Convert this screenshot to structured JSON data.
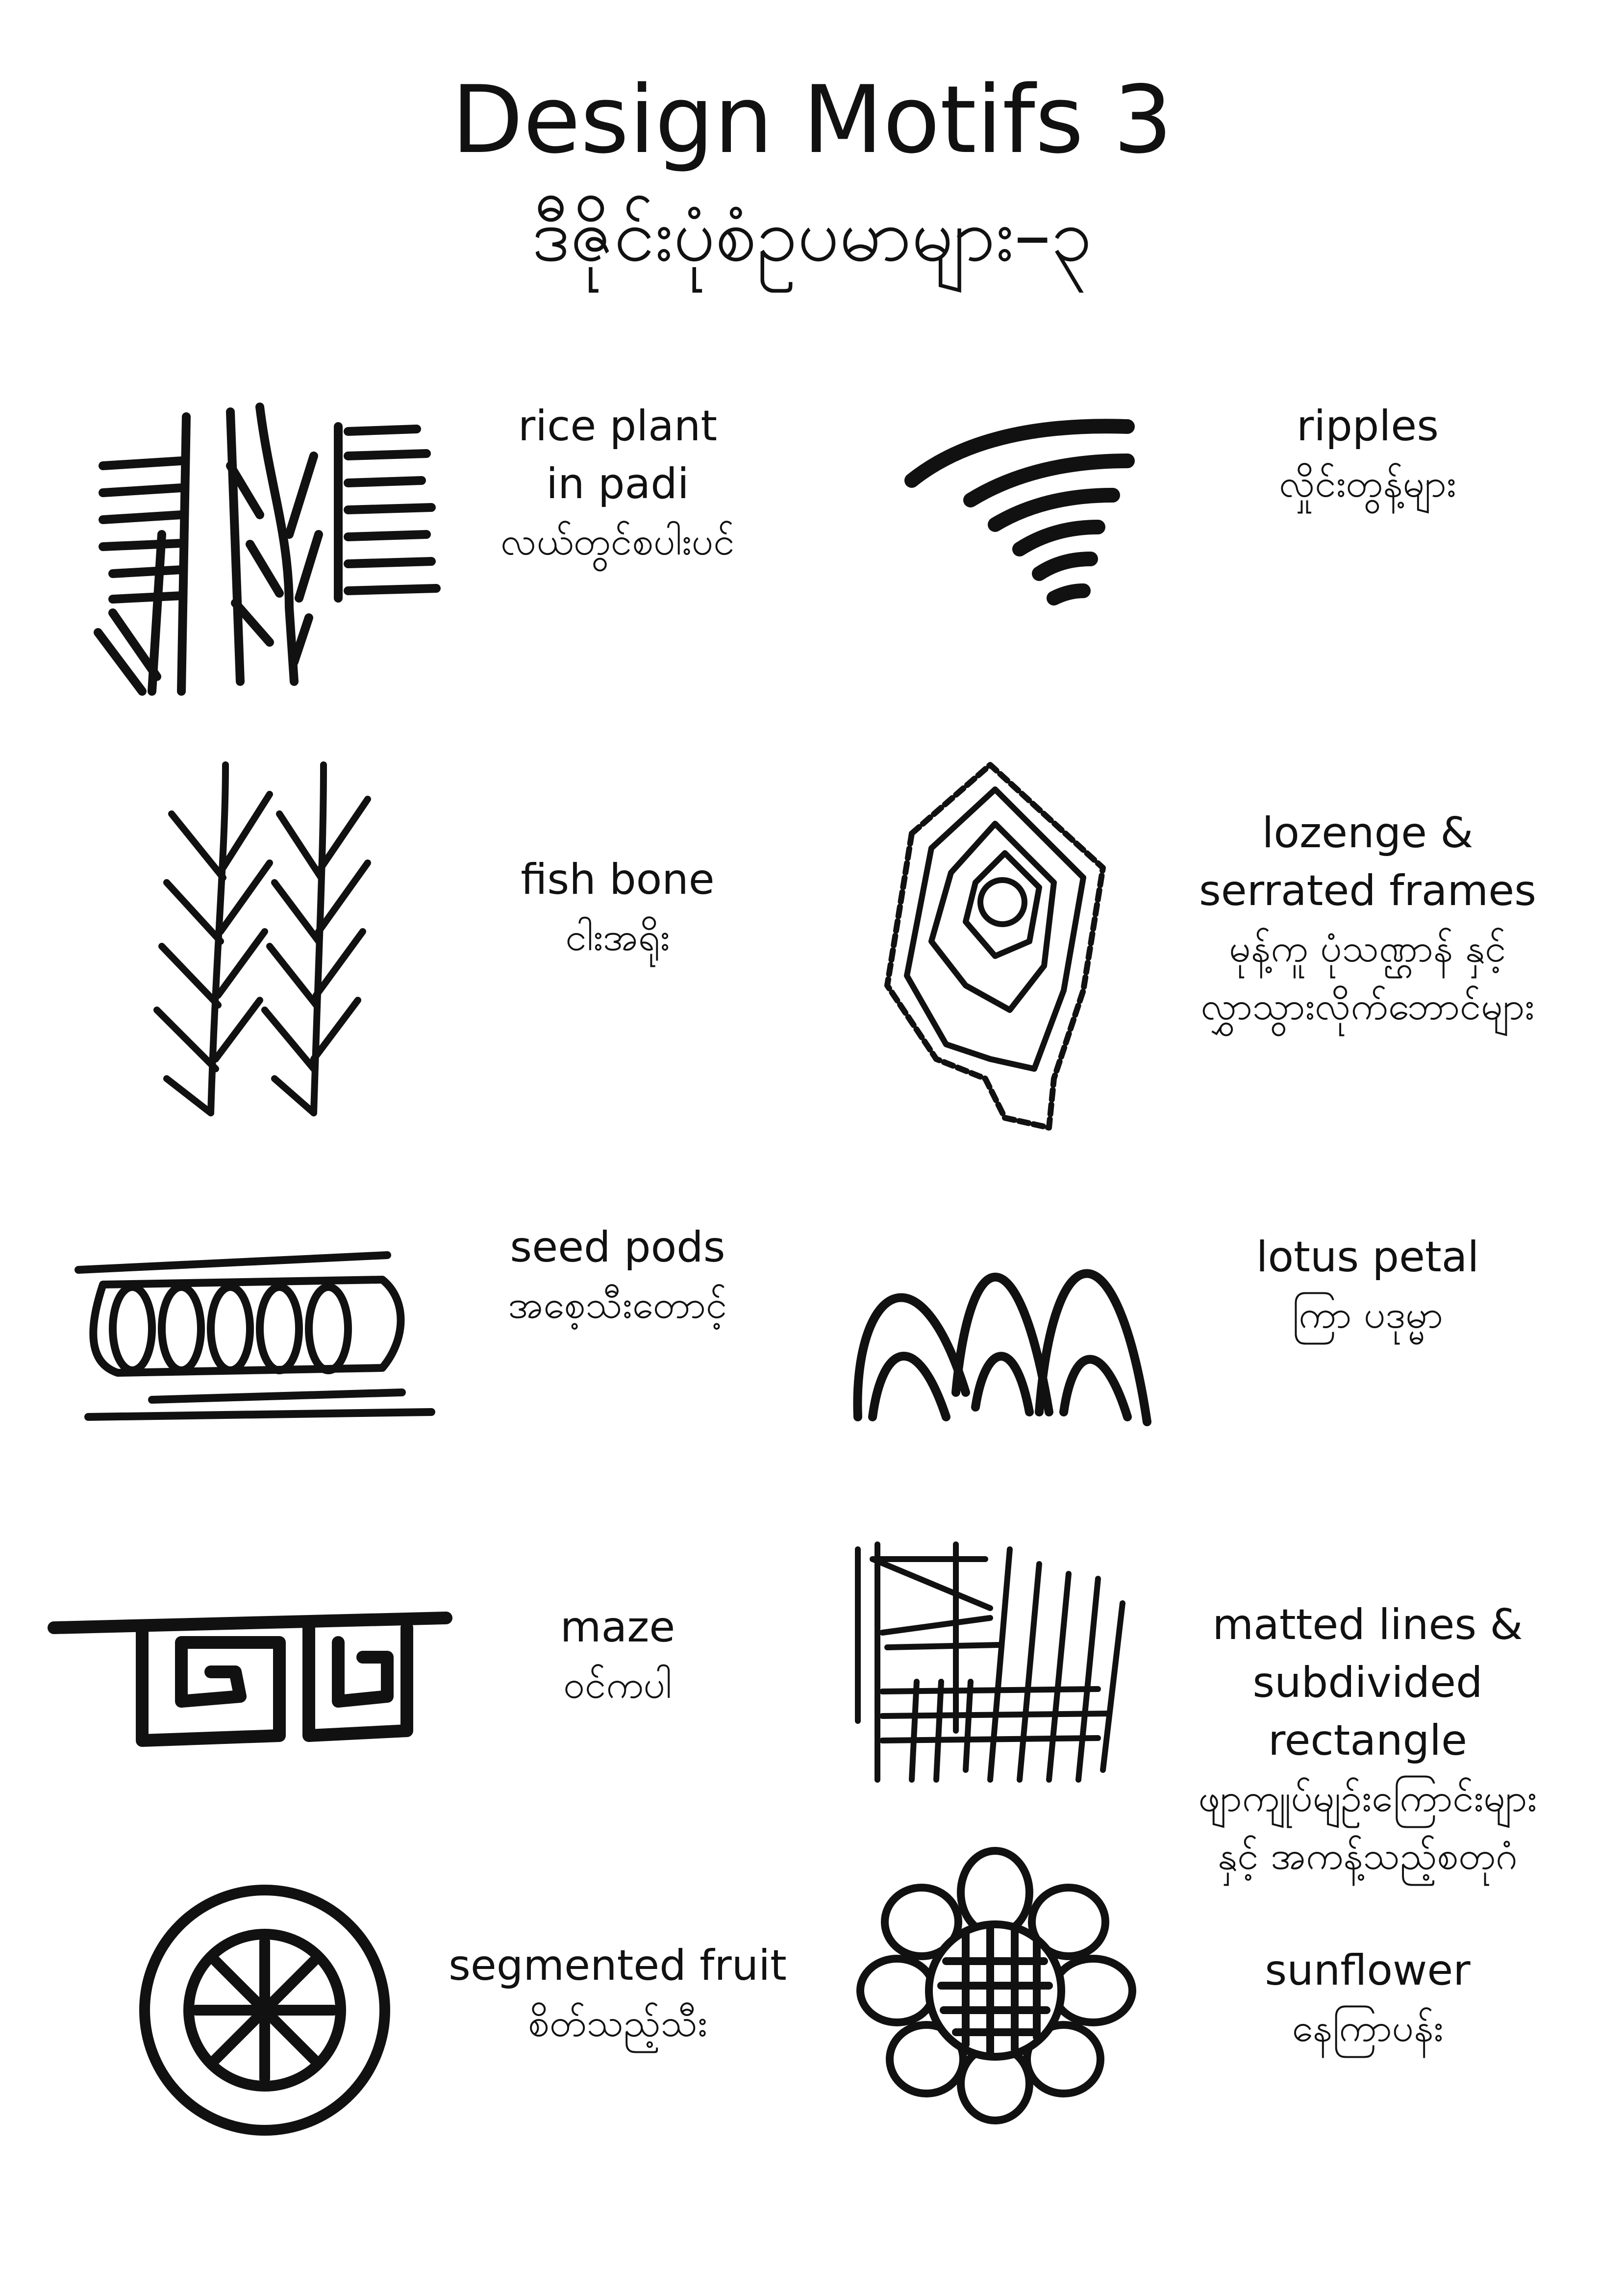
{
  "page": {
    "title_en": "Design Motifs 3",
    "title_my": "ဒီဇိုင်းပုံစံဥပမာများ–၃"
  },
  "motifs": [
    {
      "name": "rice-plant",
      "en": [
        "rice plant",
        "in padi"
      ],
      "my": [
        "လယ်တွင်စပါးပင်"
      ]
    },
    {
      "name": "ripples",
      "en": [
        "ripples"
      ],
      "my": [
        "လှိုင်းတွန့်များ"
      ]
    },
    {
      "name": "fish-bone",
      "en": [
        "fish bone"
      ],
      "my": [
        "ငါးအရိုး"
      ]
    },
    {
      "name": "lozenge",
      "en": [
        "lozenge &",
        "serrated frames"
      ],
      "my": [
        "မုန့်ကူ ပုံသဏ္ဌာန် နှင့်",
        "လွှာသွားလိုက်ဘောင်များ"
      ]
    },
    {
      "name": "seed-pods",
      "en": [
        "seed pods"
      ],
      "my": [
        "အစေ့သီးတောင့်"
      ]
    },
    {
      "name": "lotus-petal",
      "en": [
        "lotus petal"
      ],
      "my": [
        "ကြာ ပဒုမ္မာ"
      ]
    },
    {
      "name": "maze",
      "en": [
        "maze"
      ],
      "my": [
        "ဝင်ကပါ"
      ]
    },
    {
      "name": "matted-lines",
      "en": [
        "matted lines &",
        "subdivided rectangle"
      ],
      "my": [
        "ဖျာကျုပ်မျဉ်းကြောင်းများ",
        "နှင့် အကန့်သည့်စတုဂံ"
      ]
    },
    {
      "name": "segmented-fruit",
      "en": [
        "segmented fruit"
      ],
      "my": [
        "စိတ်သည့်သီး"
      ]
    },
    {
      "name": "sunflower",
      "en": [
        "sunflower"
      ],
      "my": [
        "နေကြာပန်း"
      ]
    }
  ]
}
